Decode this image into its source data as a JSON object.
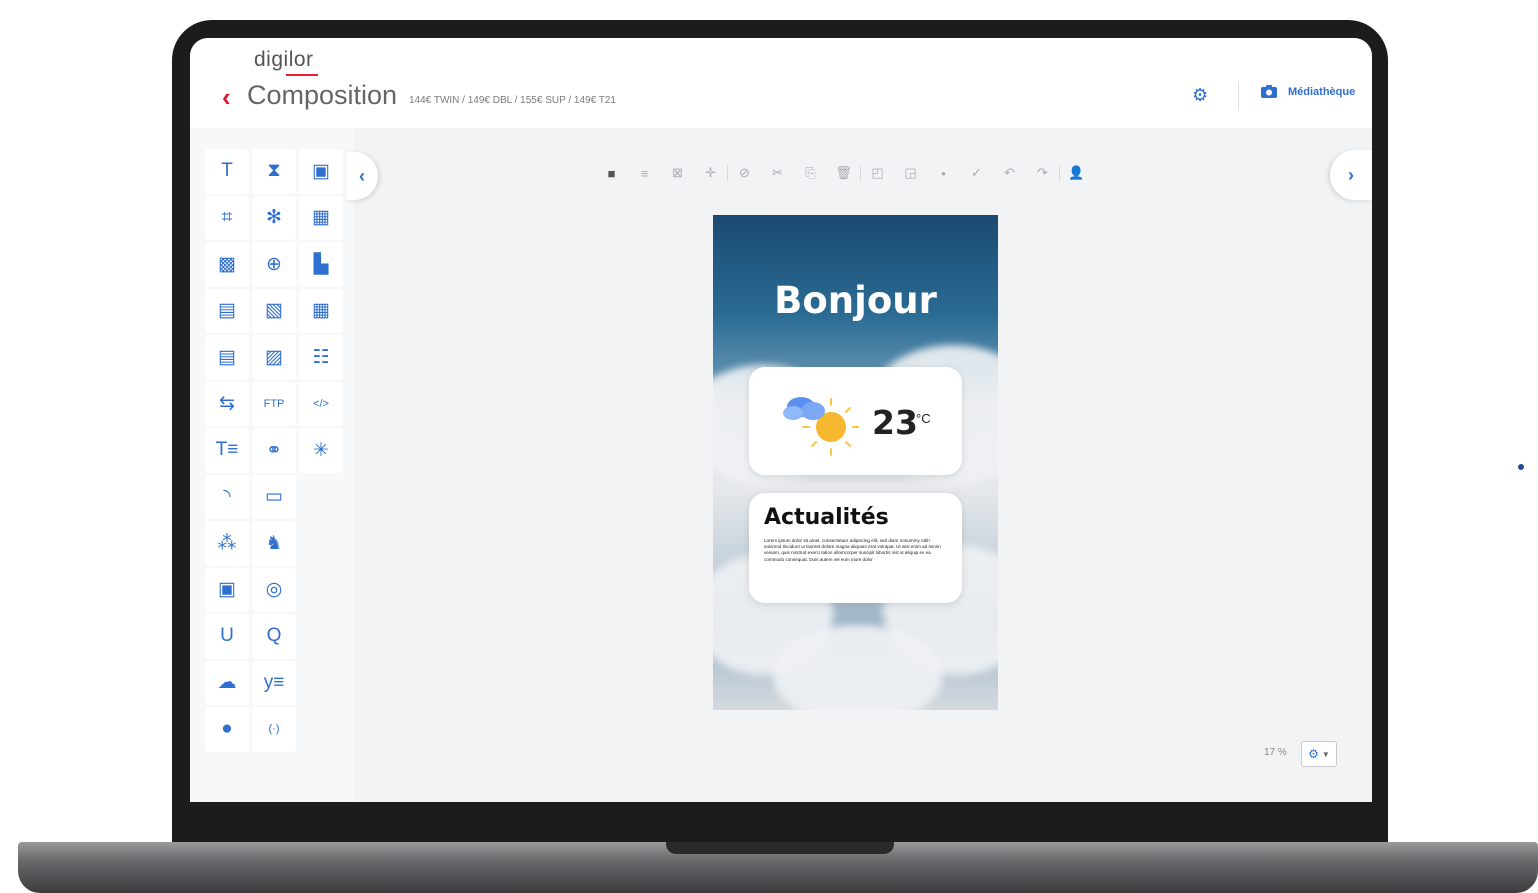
{
  "brand": {
    "name": "digilor"
  },
  "header": {
    "back_icon": "chevron-left-icon",
    "title": "Composition",
    "subtitle": "144€ TWIN / 149€ DBL / 155€ SUP / 149€ T21",
    "settings_icon": "gear-icon",
    "media_button_label": "Médiathèque",
    "media_icon": "camera-icon",
    "accent_color": "#2f6fd0",
    "back_color": "#d51a36"
  },
  "sidebar": {
    "tools": [
      {
        "name": "text-tool",
        "glyph": "T"
      },
      {
        "name": "hourglass-tool",
        "glyph": "⧗"
      },
      {
        "name": "image-gallery-tool",
        "glyph": "▣"
      },
      {
        "name": "layout-tool",
        "glyph": "⌗"
      },
      {
        "name": "people-tool",
        "glyph": "✻"
      },
      {
        "name": "calendar-tool",
        "glyph": "▦"
      },
      {
        "name": "image-tool",
        "glyph": "▩"
      },
      {
        "name": "globe-tool",
        "glyph": "⊕"
      },
      {
        "name": "chart-tool",
        "glyph": "▙"
      },
      {
        "name": "video-tool",
        "glyph": "▤"
      },
      {
        "name": "image-add-tool",
        "glyph": "▧"
      },
      {
        "name": "table-tool",
        "glyph": "▦"
      },
      {
        "name": "document-tool",
        "glyph": "▤"
      },
      {
        "name": "image-transfer-tool",
        "glyph": "▨"
      },
      {
        "name": "users-tool",
        "glyph": "☷"
      },
      {
        "name": "translate-tool",
        "glyph": "⇆"
      },
      {
        "name": "ftp-tool",
        "glyph": "FTP"
      },
      {
        "name": "code-tool",
        "glyph": "</>"
      },
      {
        "name": "text-format-tool",
        "glyph": "T≡"
      },
      {
        "name": "link-tool",
        "glyph": "⚭"
      },
      {
        "name": "loader-tool",
        "glyph": "✳"
      },
      {
        "name": "rss-tool",
        "glyph": "◝"
      },
      {
        "name": "screen-tool",
        "glyph": "▭"
      },
      {
        "name": "empty",
        "glyph": ""
      },
      {
        "name": "qr-tool",
        "glyph": "⁂"
      },
      {
        "name": "twitter-tool",
        "glyph": "♞"
      },
      {
        "name": "empty",
        "glyph": ""
      },
      {
        "name": "youtube-tool",
        "glyph": "▣"
      },
      {
        "name": "instagram-tool",
        "glyph": "◎"
      },
      {
        "name": "empty",
        "glyph": ""
      },
      {
        "name": "u-badge-tool",
        "glyph": "U"
      },
      {
        "name": "q-tool",
        "glyph": "Q"
      },
      {
        "name": "empty",
        "glyph": ""
      },
      {
        "name": "weather-tool",
        "glyph": "☁"
      },
      {
        "name": "yammer-tool",
        "glyph": "y≡"
      },
      {
        "name": "empty",
        "glyph": ""
      },
      {
        "name": "clock-tool",
        "glyph": "●"
      },
      {
        "name": "broadcast-tool",
        "glyph": "(·)"
      },
      {
        "name": "empty",
        "glyph": ""
      }
    ]
  },
  "toolbar": {
    "buttons": [
      {
        "name": "select-tool-button",
        "glyph": "■",
        "active": true
      },
      {
        "name": "align-button",
        "glyph": "≡"
      },
      {
        "name": "frame-button",
        "glyph": "⊠"
      },
      {
        "name": "move-button",
        "glyph": "✛"
      },
      {
        "sep": true
      },
      {
        "name": "copy-style-button",
        "glyph": "⊘"
      },
      {
        "name": "cut-button",
        "glyph": "✂"
      },
      {
        "name": "paste-button",
        "glyph": "⎘"
      },
      {
        "name": "delete-button",
        "glyph": "🗑"
      },
      {
        "sep": true
      },
      {
        "name": "bring-forward-button",
        "glyph": "◰"
      },
      {
        "name": "send-backward-button",
        "glyph": "◲"
      },
      {
        "name": "point-button",
        "glyph": "•"
      },
      {
        "name": "check-button",
        "glyph": "✓"
      },
      {
        "name": "undo-button",
        "glyph": "↶"
      },
      {
        "name": "redo-button",
        "glyph": "↷"
      },
      {
        "sep": true
      },
      {
        "name": "users-button",
        "glyph": "👤",
        "active": true
      }
    ]
  },
  "nav": {
    "left_arrow": "‹",
    "right_arrow": "›"
  },
  "canvas": {
    "greeting": "Bonjour",
    "temperature": "23",
    "unit": "°C",
    "weather_icon": "partly-sunny-icon",
    "news_title": "Actualités",
    "news_body": "Lorem ipsum dolor sit amet, consectetuer adipiscing elit, sed diam nonummy nibh euismod tincidunt ut laoreet dolore magna aliquam erat volutpat. Ut wisi enim ad minim veniam, quis nostrud exerci tation ullamcorper suscipit lobortis nisl ut aliquip ex ea commodo consequat. Duis autem vel eum iriure dolor"
  },
  "zoom": {
    "label": "17 %",
    "icon": "gear-icon"
  }
}
